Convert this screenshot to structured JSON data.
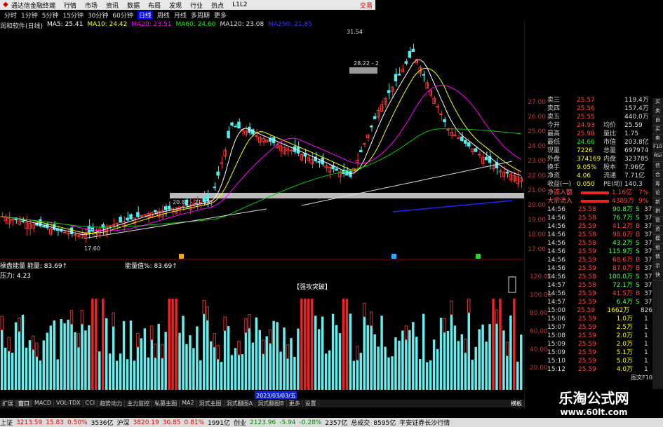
{
  "menubar": {
    "app": "通达信金融终端",
    "items": [
      "行情",
      "市场",
      "资讯",
      "数据",
      "布局",
      "发现",
      "行业",
      "热点",
      "L1L2"
    ],
    "trade": "交易"
  },
  "periods": [
    "分时",
    "1分钟",
    "5分钟",
    "15分钟",
    "30分钟",
    "60分钟",
    "日线",
    "周线",
    "月线",
    "多周期",
    "更多"
  ],
  "active_period": "日线",
  "ma": {
    "stock": "润和软件(日线)",
    "items": [
      {
        "label": "MA5: 25.41",
        "color": "#ffffff"
      },
      {
        "label": "MA10: 24.42",
        "color": "#ffff00"
      },
      {
        "label": "MA20: 23.51",
        "color": "#ff00ff"
      },
      {
        "label": "MA60: 24.60",
        "color": "#00ff00"
      },
      {
        "label": "MA120: 23.08",
        "color": "#dddddd"
      },
      {
        "label": "MA250: 21.85",
        "color": "#0000ff"
      }
    ]
  },
  "annotations": {
    "high": "31.54",
    "mid": "28.22 - 2",
    "low": "17.60",
    "zone": "20.87 - 21.25",
    "ind_label": "【强攻突破】",
    "date": "2023/03/03/五"
  },
  "ind_legend": {
    "name": "操盘能量",
    "line1": "能量: 83.69↑",
    "line2": "压力: 4.23",
    "line3": "能量值%: 83.69↑"
  },
  "y_main": [
    "27.00",
    "26.00",
    "25.00",
    "24.00",
    "23.00",
    "22.00",
    "21.00",
    "20.00",
    "19.00",
    "18.00",
    "17.00"
  ],
  "y_ind": [
    "120.00",
    "100.00",
    "80.00",
    "60.00",
    "40.00",
    "20.00"
  ],
  "ctrlbar": [
    "扩展",
    "窗口",
    "MACD",
    "VOL-TDX",
    "CCI",
    "趋势动力",
    "主力监控",
    "私募主图",
    "MA2",
    "洞式主图",
    "洞式翻图A",
    "洞式翻图B",
    "更多",
    "设置"
  ],
  "ctrl_active": "窗口",
  "ctrl_vert": "横板",
  "quote": [
    {
      "l": "卖三",
      "v": "25.57",
      "r": "119.4万"
    },
    {
      "l": "卖四",
      "v": "25.56",
      "r": "157.4万"
    },
    {
      "l": "卖五",
      "v": "25.55",
      "r": "440.0万"
    },
    {
      "l": "今开",
      "v": "24.93",
      "l2": "均价",
      "r": "25.59"
    },
    {
      "l": "最高",
      "v": "25.98",
      "l2": "量比",
      "r": "1.75"
    },
    {
      "l": "最低",
      "v": "24.66",
      "l2": "市值",
      "r": "203.8亿"
    },
    {
      "l": "现量",
      "v": "7226",
      "l2": "总量",
      "r": "697974"
    },
    {
      "l": "外盘",
      "v": "374169",
      "l2": "内盘",
      "r": "323785"
    },
    {
      "l": "换手",
      "v": "9.05%",
      "l2": "股本",
      "r": "7.96亿"
    },
    {
      "l": "净资",
      "v": "4.06",
      "l2": "流通",
      "r": "7.71亿"
    },
    {
      "l": "收益(一)",
      "v": "0.050",
      "l2": "PE(动)",
      "r": "140.3"
    }
  ],
  "flows": [
    {
      "l": "净流入额",
      "r": "1.16亿",
      "pct": "7%"
    },
    {
      "l": "大宗流入",
      "r": "4389万",
      "pct": "9%"
    }
  ],
  "ticks": [
    {
      "t": "14:56",
      "p": "25.58",
      "v": "90.8万",
      "d": "S",
      "n": "37"
    },
    {
      "t": "14:56",
      "p": "25.58",
      "v": "76.7万",
      "d": "S",
      "n": "37"
    },
    {
      "t": "14:56",
      "p": "25.59",
      "v": "41.2万",
      "d": "B",
      "n": "37"
    },
    {
      "t": "14:56",
      "p": "25.58",
      "v": "98.0万",
      "d": "B",
      "n": "37"
    },
    {
      "t": "14:56",
      "p": "25.58",
      "v": "43.2万",
      "d": "S",
      "n": "37"
    },
    {
      "t": "14:56",
      "p": "25.59",
      "v": "115.9万",
      "d": "S",
      "n": "37"
    },
    {
      "t": "14:56",
      "p": "25.59",
      "v": "68.6万",
      "d": "B",
      "n": "37"
    },
    {
      "t": "14:56",
      "p": "25.59",
      "v": "87.0万",
      "d": "B",
      "n": "37"
    },
    {
      "t": "14:56",
      "p": "25.58",
      "v": "100.0万",
      "d": "S",
      "n": "37"
    },
    {
      "t": "14:57",
      "p": "25.58",
      "v": "72.1万",
      "d": "S",
      "n": "37"
    },
    {
      "t": "14:56",
      "p": "25.59",
      "v": "41.5万",
      "d": "B",
      "n": "37"
    },
    {
      "t": "14:57",
      "p": "25.59",
      "v": "6.4万",
      "d": "S",
      "n": "37"
    },
    {
      "t": "15:00",
      "p": "25.59",
      "v": "1662万",
      "d": "",
      "n": "826"
    },
    {
      "t": "15:06",
      "p": "25.59",
      "v": "1.0万",
      "d": "",
      "n": "1"
    },
    {
      "t": "15:07",
      "p": "25.59",
      "v": "2.5万",
      "d": "",
      "n": "1"
    },
    {
      "t": "15:08",
      "p": "25.59",
      "v": "2.0万",
      "d": "",
      "n": "1"
    },
    {
      "t": "15:09",
      "p": "25.59",
      "v": "2.0万",
      "d": "",
      "n": "1"
    },
    {
      "t": "15:09",
      "p": "25.59",
      "v": "5.1万",
      "d": "",
      "n": "1"
    },
    {
      "t": "15:10",
      "p": "25.59",
      "v": "5.0万",
      "d": "",
      "n": "1"
    },
    {
      "t": "15:12",
      "p": "25.59",
      "v": "4.0万",
      "d": "",
      "n": "1"
    }
  ],
  "panel_footer": "图文F10",
  "side_icons": [
    "买",
    "卖",
    "自",
    "买",
    "卖",
    "F10",
    "RSI",
    "信",
    "合",
    "筹",
    "论",
    "新",
    "拼",
    "管",
    "资",
    "模",
    "组",
    "情",
    "示",
    "快"
  ],
  "watermark": {
    "t1": "乐淘公式网",
    "t2": "www.60lt.com"
  },
  "status": [
    {
      "t": "上证",
      "c": "#000"
    },
    {
      "t": "3213.59",
      "c": "#e00"
    },
    {
      "t": "15.83",
      "c": "#e00"
    },
    {
      "t": "0.50%",
      "c": "#e00"
    },
    {
      "t": "3536亿",
      "c": "#000"
    },
    {
      "t": "沪深",
      "c": "#000"
    },
    {
      "t": "3820.19",
      "c": "#e00"
    },
    {
      "t": "30.85",
      "c": "#e00"
    },
    {
      "t": "0.81%",
      "c": "#e00"
    },
    {
      "t": "1991亿",
      "c": "#000"
    },
    {
      "t": "创业",
      "c": "#000"
    },
    {
      "t": "2123.96",
      "c": "#080"
    },
    {
      "t": "-5.94",
      "c": "#080"
    },
    {
      "t": "-0.28%",
      "c": "#080"
    },
    {
      "t": "2357亿",
      "c": "#000"
    },
    {
      "t": "总成交",
      "c": "#000"
    },
    {
      "t": "8595亿",
      "c": "#000"
    },
    {
      "t": "平安证券长沙行情",
      "c": "#000"
    }
  ],
  "chart_data": {
    "type": "candlestick",
    "ylim": [
      17,
      27.5
    ],
    "ind_ylim": [
      0,
      130
    ]
  }
}
